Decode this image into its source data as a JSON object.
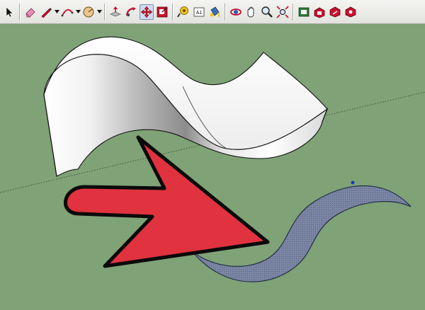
{
  "toolbar": {
    "buttons": [
      {
        "id": "select",
        "icon": "select-arrow-icon",
        "dropdown": false
      },
      {
        "id": "eraser",
        "icon": "eraser-icon",
        "dropdown": false
      },
      {
        "id": "line",
        "icon": "pencil-icon",
        "dropdown": true
      },
      {
        "id": "arc",
        "icon": "arc-icon",
        "dropdown": true
      },
      {
        "id": "protractor",
        "icon": "protractor-icon",
        "dropdown": true
      },
      {
        "id": "push-pull",
        "icon": "push-pull-icon",
        "dropdown": false
      },
      {
        "id": "follow-me",
        "icon": "follow-me-icon",
        "dropdown": false
      },
      {
        "id": "move",
        "icon": "move-icon",
        "dropdown": false,
        "active": true
      },
      {
        "id": "scale",
        "icon": "scale-icon",
        "dropdown": false
      },
      {
        "id": "tape-measure",
        "icon": "tape-measure-icon",
        "dropdown": false
      },
      {
        "id": "text",
        "icon": "text-icon",
        "dropdown": false,
        "label": "A1"
      },
      {
        "id": "paint-bucket",
        "icon": "paint-bucket-icon",
        "dropdown": false
      },
      {
        "id": "orbit",
        "icon": "orbit-icon",
        "dropdown": false
      },
      {
        "id": "pan",
        "icon": "pan-hand-icon",
        "dropdown": false
      },
      {
        "id": "zoom",
        "icon": "zoom-icon",
        "dropdown": false
      },
      {
        "id": "zoom-extents",
        "icon": "zoom-extents-icon",
        "dropdown": false
      },
      {
        "id": "3d-warehouse",
        "icon": "warehouse-icon",
        "dropdown": false
      },
      {
        "id": "get-models",
        "icon": "get-models-icon",
        "dropdown": false
      },
      {
        "id": "share-model",
        "icon": "share-model-icon",
        "dropdown": false
      },
      {
        "id": "extension-warehouse",
        "icon": "extension-warehouse-icon",
        "dropdown": false
      }
    ]
  },
  "colors": {
    "ground": "#7fa277",
    "selected_face": "#7d88a6",
    "arrow": "#e0323f",
    "active_tool": "#cfdcf0"
  }
}
